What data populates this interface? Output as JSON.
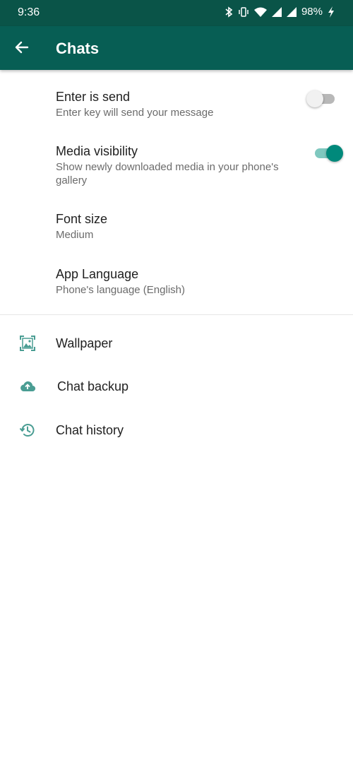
{
  "status_bar": {
    "time": "9:36",
    "battery": "98%",
    "icons": [
      "bluetooth-icon",
      "vibrate-icon",
      "wifi-icon",
      "signal-icon",
      "signal-icon",
      "charging-icon"
    ]
  },
  "app_bar": {
    "title": "Chats",
    "back_icon": "arrow-left-icon"
  },
  "settings": {
    "enter_is_send": {
      "title": "Enter is send",
      "subtitle": "Enter key will send your message",
      "enabled": false
    },
    "media_visibility": {
      "title": "Media visibility",
      "subtitle": "Show newly downloaded media in your phone's gallery",
      "enabled": true
    },
    "font_size": {
      "title": "Font size",
      "value": "Medium"
    },
    "app_language": {
      "title": "App Language",
      "value": "Phone's language (English)"
    }
  },
  "links": {
    "wallpaper": {
      "label": "Wallpaper",
      "icon": "wallpaper-icon"
    },
    "chat_backup": {
      "label": "Chat backup",
      "icon": "cloud-upload-icon"
    },
    "chat_history": {
      "label": "Chat history",
      "icon": "history-icon"
    }
  },
  "colors": {
    "status_bar": "#0a5448",
    "app_bar": "#075e54",
    "accent": "#00897b",
    "icon_tint": "#4a9d93"
  }
}
